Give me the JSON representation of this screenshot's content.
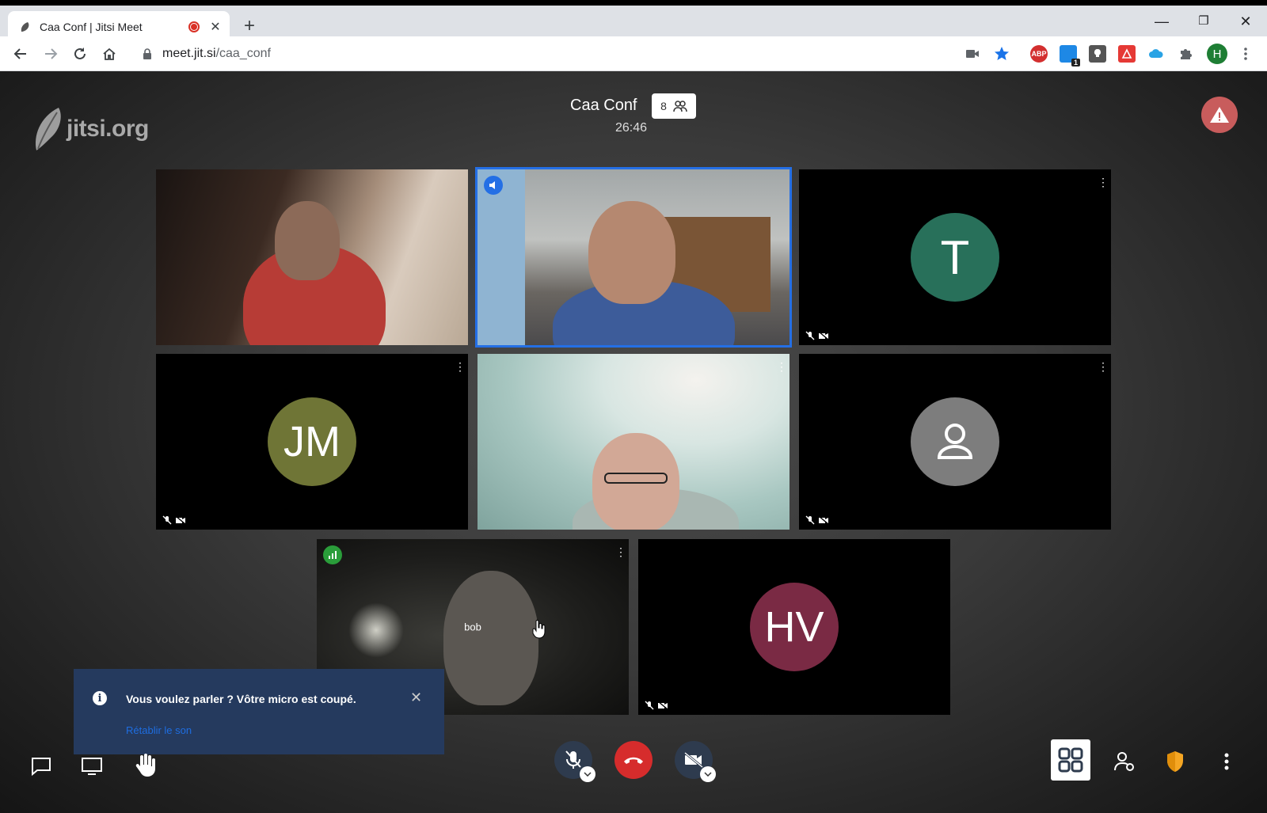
{
  "browser": {
    "tab_title": "Caa Conf | Jitsi Meet",
    "url_host": "meet.jit.si",
    "url_path": "/caa_conf",
    "profile_initial": "H",
    "extension_badge": "1",
    "abp_label": "ABP"
  },
  "meeting": {
    "logo_text": "jitsi.org",
    "title": "Caa Conf",
    "participant_count": "8",
    "elapsed": "26:46"
  },
  "participants": [
    {
      "name": "",
      "initials": "",
      "video": true
    },
    {
      "name": "",
      "initials": "",
      "video": true,
      "dominant_speaker": true
    },
    {
      "name": "",
      "initials": "T",
      "video": false,
      "avatar_color": "#28705a"
    },
    {
      "name": "",
      "initials": "JM",
      "video": false,
      "avatar_color": "#6f7536"
    },
    {
      "name": "",
      "initials": "",
      "video": true
    },
    {
      "name": "",
      "initials": "",
      "video": false,
      "avatar_color": "#7d7d7d"
    },
    {
      "name": "bob",
      "initials": "",
      "video": true,
      "local": true
    },
    {
      "name": "",
      "initials": "HV",
      "video": false,
      "avatar_color": "#7a2a44"
    }
  ],
  "notification": {
    "message": "Vous voulez parler ? Vôtre micro est coupé.",
    "action": "Rétablir le son"
  },
  "colors": {
    "hangup": "#d62c2c",
    "accent": "#246fe5",
    "notification_bg": "#253a5e"
  }
}
